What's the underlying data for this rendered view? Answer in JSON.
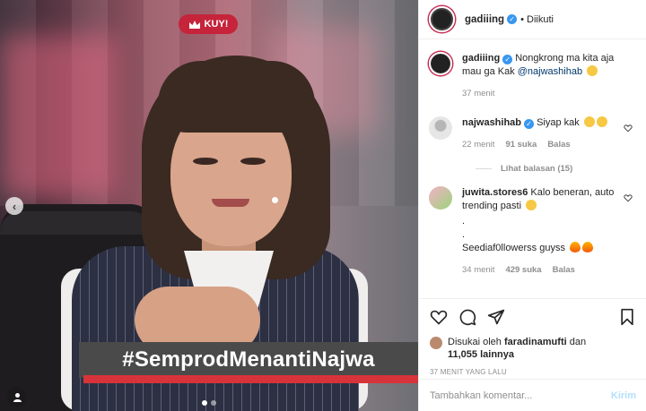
{
  "media": {
    "badge_label": "KUY!",
    "banner_text": "#SemprodMenantiNajwa",
    "carousel_dots": 2,
    "active_dot": 0
  },
  "post": {
    "author": "gadiiing",
    "follow_status": "• Diikuti",
    "caption_user": "gadiiing",
    "caption_text": "Nongkrong ma kita aja mau ga Kak ",
    "caption_mention": "@najwashihab",
    "caption_time": "37 menit"
  },
  "comments": [
    {
      "user": "najwashihab",
      "verified": true,
      "text": "Siyap kak",
      "time": "22 menit",
      "likes": "91 suka",
      "reply": "Balas",
      "view_replies": "Lihat balasan (15)"
    },
    {
      "user": "juwita.stores6",
      "verified": false,
      "text": "Kalo beneran, auto trending pasti",
      "extra_lines": [
        ".",
        ".",
        "Seediaf0llowerss guyss"
      ],
      "time": "34 menit",
      "likes": "429 suka",
      "reply": "Balas"
    }
  ],
  "likes": {
    "prefix": "Disukai oleh",
    "user": "faradinamufti",
    "connector": "dan",
    "count": "11,055 lainnya"
  },
  "timestamp": "37 MENIT YANG LALU",
  "add_comment": {
    "placeholder": "Tambahkan komentar...",
    "send_label": "Kirim"
  },
  "colors": {
    "verified": "#3897f0",
    "send_disabled": "#b2dffc",
    "badge": "#c5243a",
    "banner_red": "#d7333a"
  }
}
